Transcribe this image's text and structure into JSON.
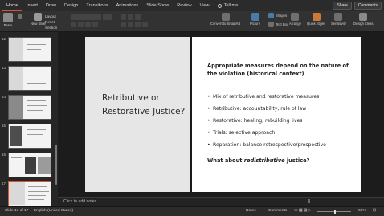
{
  "ribbon": {
    "tabs": [
      "Home",
      "Insert",
      "Draw",
      "Design",
      "Transitions",
      "Animations",
      "Slide Show",
      "Review",
      "View"
    ],
    "active_tab": "Home",
    "tell_me": "Tell me",
    "share": "Share",
    "comments": "Comments",
    "paste": "Paste",
    "new_slide": "New Slide",
    "layout": "Layout",
    "reset": "Reset",
    "section": "Section",
    "convert_smartart": "Convert to SmartArt",
    "picture": "Picture",
    "shapes": "Shapes",
    "text_box": "Text Box",
    "arrange": "Arrange",
    "quick_styles": "Quick Styles",
    "sensitivity": "Sensitivity",
    "design_ideas": "Design Ideas"
  },
  "thumbnails": {
    "numbers": [
      "12",
      "13",
      "14",
      "15",
      "16",
      "17"
    ],
    "selected": "17"
  },
  "slide": {
    "title": "Retributive or Restorative Justice?",
    "heading": "Appropriate measures depend on the nature of the violation (historical context)",
    "bullets": [
      "Mix of retributive and restorative measures",
      "Retributive: accountability, rule of law",
      "Restorative: healing, rebuilding lives",
      "Trials: selective approach",
      "Reparation: balance retrospective/prospective"
    ],
    "final_prefix": "What about ",
    "final_emphasis": "redistributive",
    "final_suffix": " justice?"
  },
  "notes_placeholder": "Click to add notes",
  "status": {
    "slide_count": "Slide 17 of 17",
    "language": "English (United States)",
    "notes": "Notes",
    "comments": "Comments",
    "zoom": "69%"
  },
  "colors": {
    "accent": "#d65532",
    "slide_left_panel": "#e6e6e6",
    "app_background": "#1e1e1e"
  }
}
